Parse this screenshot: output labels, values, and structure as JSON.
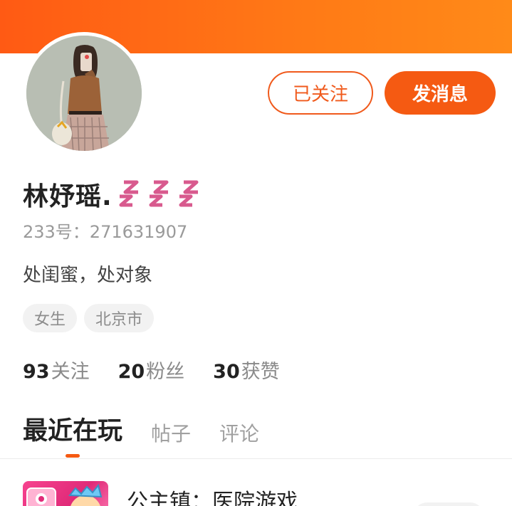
{
  "theme": {
    "accent": "#f55a12",
    "banner": "#ff7a16"
  },
  "profile": {
    "name": "林妤瑶.",
    "uid": "233号：271631907",
    "bio": "处闺蜜，处对象",
    "tags": [
      "女生",
      "北京市"
    ]
  },
  "actions": {
    "follow_label": "已关注",
    "message_label": "发消息"
  },
  "stats": [
    {
      "value": "93",
      "label": "关注"
    },
    {
      "value": "20",
      "label": "粉丝"
    },
    {
      "value": "30",
      "label": "获赞"
    }
  ],
  "tabs": [
    {
      "label": "最近在玩",
      "active": true
    },
    {
      "label": "帖子",
      "active": false
    },
    {
      "label": "评论",
      "active": false
    }
  ],
  "recent_games": [
    {
      "title": "公主镇：医院游戏"
    }
  ],
  "icons": {
    "avatar": "avatar-girl-illustration",
    "name_badge": "zzz-sleep-icon"
  }
}
